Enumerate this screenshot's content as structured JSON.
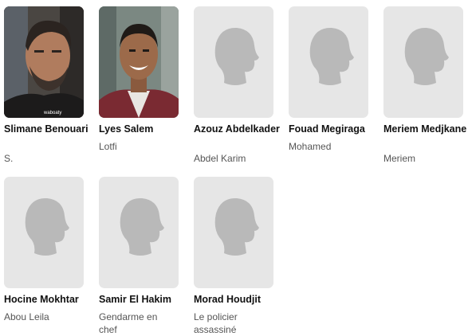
{
  "cast": [
    {
      "name": "Slimane Benouari",
      "role": "S.",
      "photo": "actor-photo",
      "watermark": "waboaty"
    },
    {
      "name": "Lyes Salem",
      "role": "Lotfi",
      "photo": "actor-photo"
    },
    {
      "name": "Azouz Abdelkader",
      "role": "Abdel Karim",
      "photo": "placeholder-silhouette"
    },
    {
      "name": "Fouad Megiraga",
      "role": "Mohamed",
      "photo": "placeholder-silhouette"
    },
    {
      "name": "Meriem Medjkane",
      "role": "Meriem",
      "photo": "placeholder-silhouette"
    },
    {
      "name": "Hocine Mokhtar",
      "role": "Abou Leila",
      "photo": "placeholder-silhouette"
    },
    {
      "name": "Samir El Hakim",
      "role": "Gendarme en chef",
      "photo": "placeholder-silhouette"
    },
    {
      "name": "Morad Houdjit",
      "role": "Le policier assassiné",
      "photo": "placeholder-silhouette"
    }
  ],
  "colors": {
    "placeholder_bg": "#e6e6e6",
    "silhouette": "#b9b9b9",
    "name_text": "#111111",
    "role_text": "#555555"
  }
}
